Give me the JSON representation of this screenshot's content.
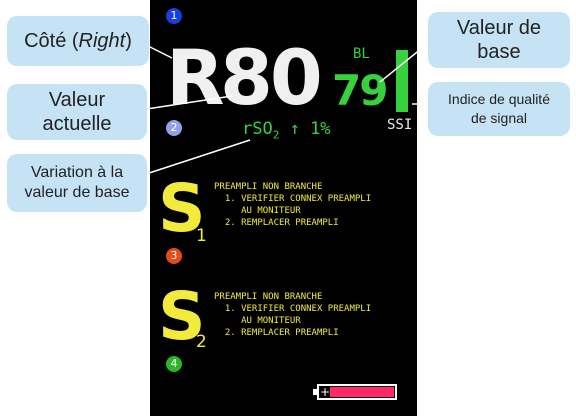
{
  "monitor": {
    "side_letter": "R",
    "current_value": "80",
    "baseline_marker": "BL",
    "baseline_value": "79",
    "ssi_label": "SSI",
    "ssi_level": 1.0,
    "rso2_prefix": "rSO",
    "rso2_sub": "2",
    "rso2_change": "↑ 1%",
    "channel_dots": [
      {
        "label": "1",
        "color": "#1a3de0"
      },
      {
        "label": "2",
        "color": "#8fa2e8"
      },
      {
        "label": "3",
        "color": "#e84a1c"
      },
      {
        "label": "4",
        "color": "#2ab52a"
      }
    ],
    "sensor1": {
      "letter": "S",
      "sub": "1",
      "message": "PREAMPLI NON BRANCHE\n  1. VERIFIER CONNEX PREAMPLI\n     AU MONITEUR\n  2. REMPLACER PREAMPLI"
    },
    "sensor2": {
      "letter": "S",
      "sub": "2",
      "message": "PREAMPLI NON BRANCHE\n  1. VERIFIER CONNEX PREAMPLI\n     AU MONITEUR\n  2. REMPLACER PREAMPLI"
    },
    "battery": {
      "plus": "+",
      "color": "#ff2a66"
    }
  },
  "callouts": {
    "side": {
      "text": "Côté (",
      "em": "Right",
      "close": ")"
    },
    "current": "Valeur\nactuelle",
    "change": "Variation à la\nvaleur de base",
    "baseline": "Valeur de\nbase",
    "ssi": "Indice de qualité\nde signal"
  }
}
